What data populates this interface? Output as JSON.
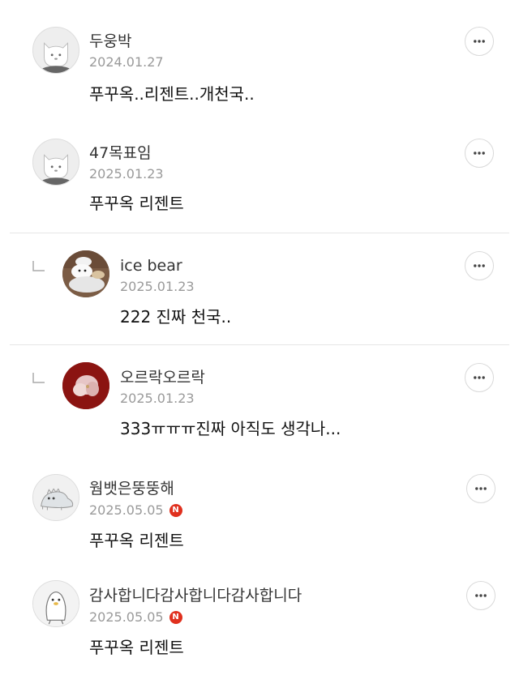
{
  "comments": [
    {
      "author": "두웅박",
      "date": "2024.01.27",
      "text": "푸꾸옥..리젠트..개천국..",
      "avatar": "default-cat-icon",
      "is_reply": false,
      "naver_badge": false
    },
    {
      "author": "47목표임",
      "date": "2025.01.23",
      "text": "푸꾸옥 리젠트",
      "avatar": "default-cat-icon",
      "is_reply": false,
      "naver_badge": false
    },
    {
      "author": "ice bear",
      "date": "2025.01.23",
      "text": "222 진짜 천국..",
      "avatar": "bear-photo",
      "is_reply": true,
      "naver_badge": false
    },
    {
      "author": "오르락오르락",
      "date": "2025.01.23",
      "text": "333ㅠㅠㅠ진짜 아직도 생각나...",
      "avatar": "red-photo",
      "is_reply": true,
      "naver_badge": false
    },
    {
      "author": "웜뱃은뚱뚱해",
      "date": "2025.05.05",
      "text": "푸꾸옥 리젠트",
      "avatar": "dinosaur-icon",
      "is_reply": false,
      "naver_badge": true,
      "badge_label": "N"
    },
    {
      "author": "감사합니다감사합니다감사합니다",
      "date": "2025.05.05",
      "text": "푸꾸옥 리젠트",
      "avatar": "penguin-icon",
      "is_reply": false,
      "naver_badge": true,
      "badge_label": "N"
    }
  ],
  "colors": {
    "naver_badge": "#e0301e",
    "date_text": "#9a9a9a",
    "divider": "#e6e6e6"
  }
}
